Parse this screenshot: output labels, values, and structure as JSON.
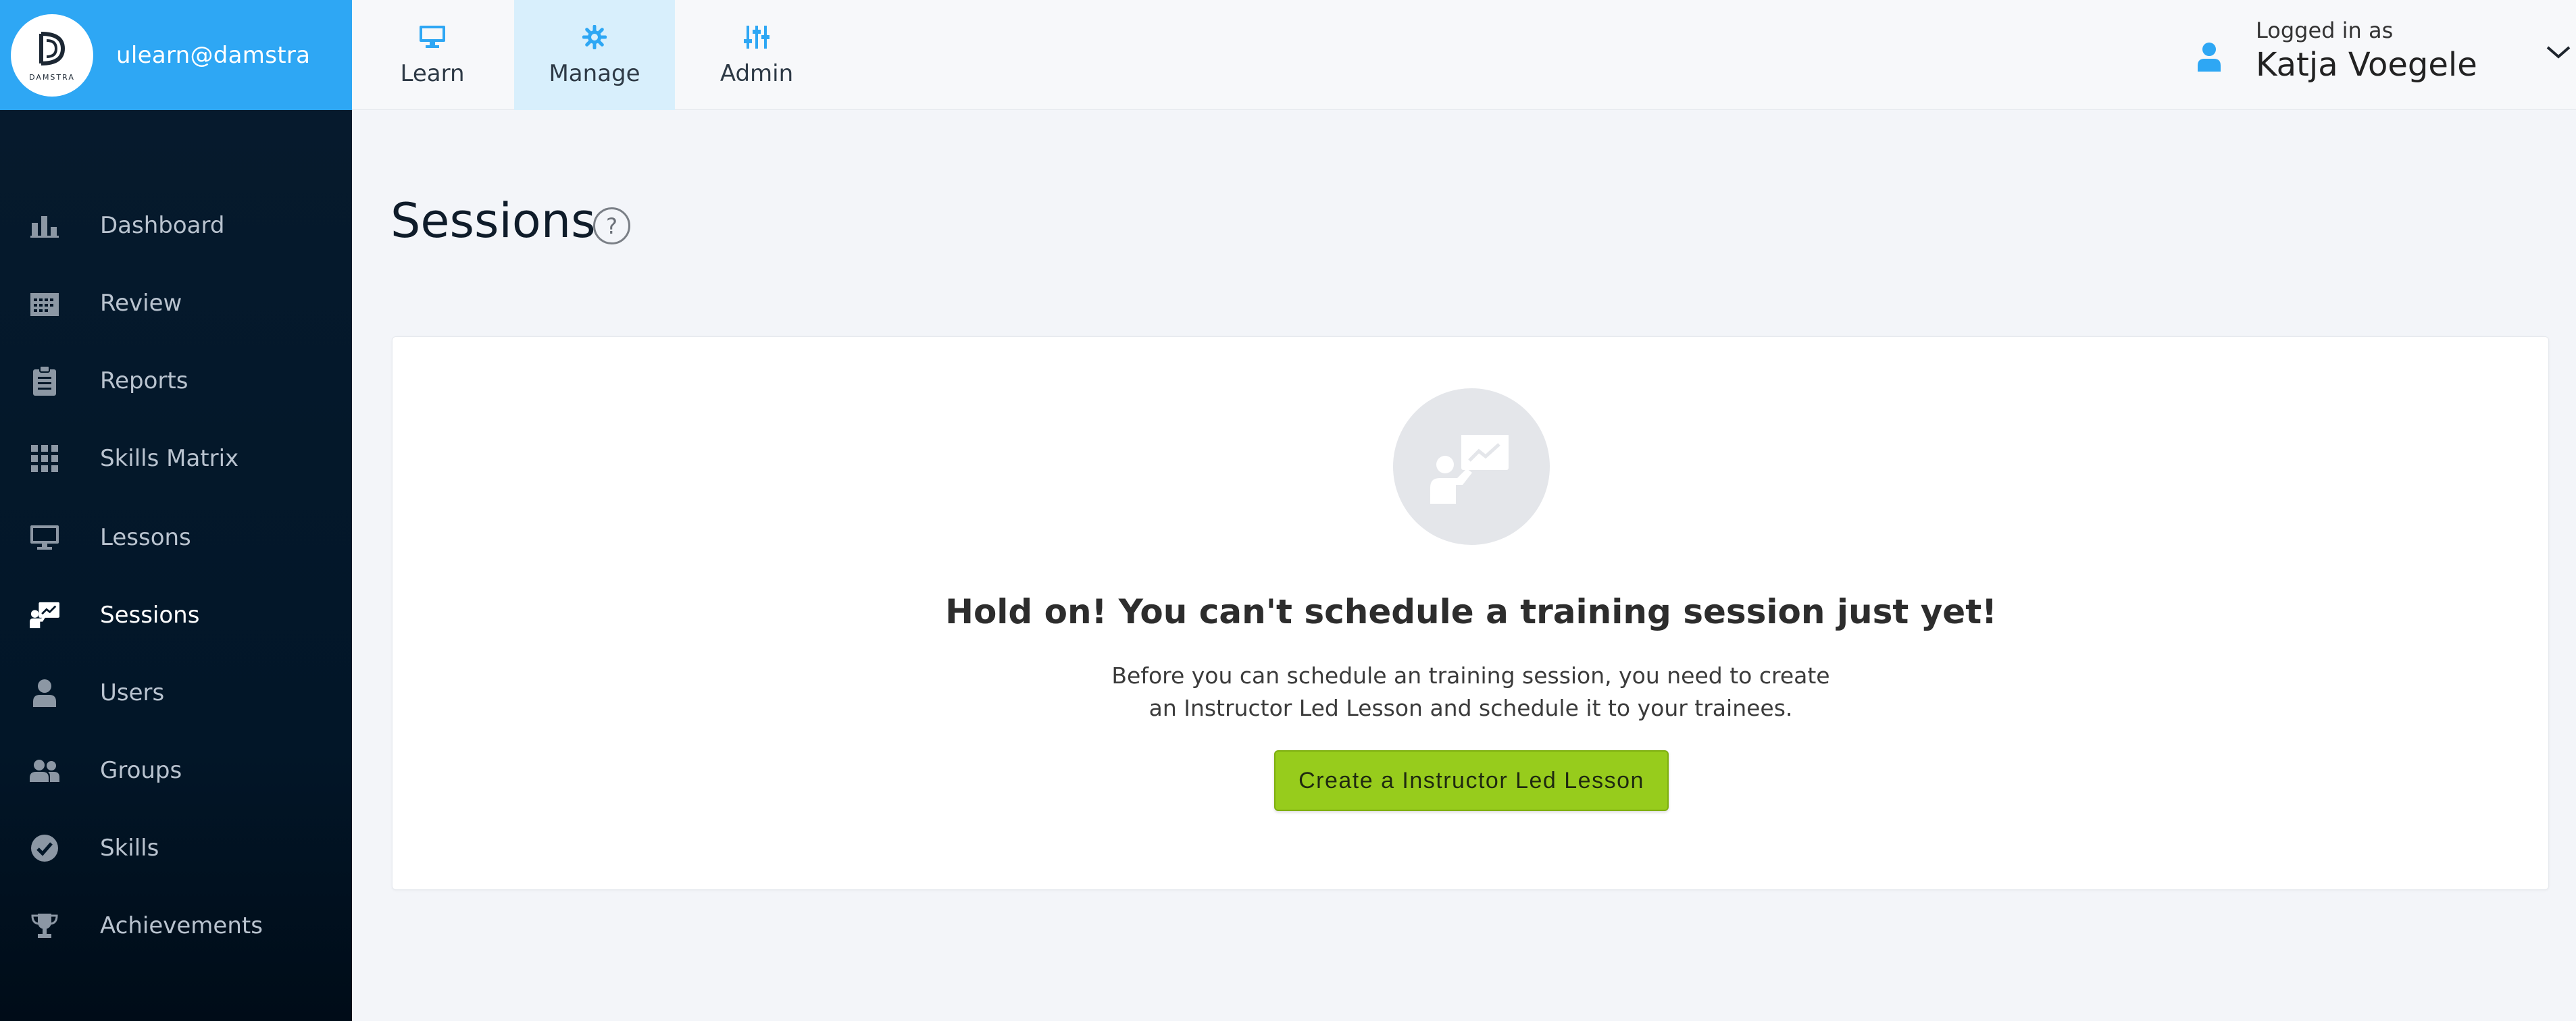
{
  "brand": {
    "account": "ulearn@damstra",
    "logo_text": "DAMSTRA"
  },
  "top_tabs": [
    {
      "label": "Learn",
      "icon": "monitor-icon",
      "active": false
    },
    {
      "label": "Manage",
      "icon": "gear-icon",
      "active": true
    },
    {
      "label": "Admin",
      "icon": "sliders-icon",
      "active": false
    }
  ],
  "user": {
    "logged_in_label": "Logged in as",
    "name": "Katja Voegele"
  },
  "sidebar": {
    "items": [
      {
        "label": "Dashboard",
        "icon": "bar-chart-icon"
      },
      {
        "label": "Review",
        "icon": "calendar-icon"
      },
      {
        "label": "Reports",
        "icon": "clipboard-icon"
      },
      {
        "label": "Skills Matrix",
        "icon": "grid-icon"
      },
      {
        "label": "Lessons",
        "icon": "monitor-icon"
      },
      {
        "label": "Sessions",
        "icon": "presentation-icon",
        "active": true
      },
      {
        "label": "Users",
        "icon": "user-icon"
      },
      {
        "label": "Groups",
        "icon": "users-icon"
      },
      {
        "label": "Skills",
        "icon": "check-circle-icon"
      },
      {
        "label": "Achievements",
        "icon": "trophy-icon"
      }
    ]
  },
  "main": {
    "title": "Sessions",
    "help": "?",
    "empty_state": {
      "heading": "Hold on! You can't schedule a training session just yet!",
      "description": "Before you can schedule an training session, you need to create an Instructor Led Lesson and schedule it to your trainees.",
      "button": "Create a Instructor Led Lesson"
    }
  },
  "colors": {
    "brand": "#2ea7f4",
    "sidebar_bg": "#021628",
    "active_tab_bg": "#d8effc",
    "cta_green": "#97cc1c",
    "page_bg": "#f3f5f9"
  }
}
